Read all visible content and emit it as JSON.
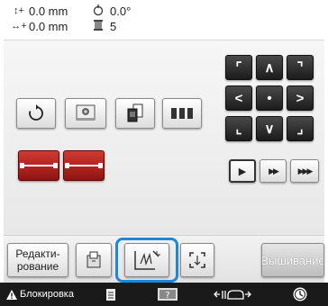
{
  "status": {
    "vertical_icon": "↕+",
    "vertical_offset": "0.0 mm",
    "horizontal_icon": "↔+",
    "horizontal_offset": "0.0 mm",
    "rotation_icon": "rotation-icon",
    "rotation_value": "0.0°",
    "spool_icon": "thread-spool-icon",
    "color_count": "5"
  },
  "edit_buttons": [
    {
      "name": "rotate-button",
      "icon": "rotate-icon"
    },
    {
      "name": "pattern-button",
      "icon": "pattern-icon"
    },
    {
      "name": "copy-button",
      "icon": "copy-pattern-icon"
    },
    {
      "name": "array-button",
      "icon": "array-icon"
    }
  ],
  "stitch_buttons": [
    {
      "name": "stitch-trim-start-button"
    },
    {
      "name": "stitch-trim-end-button"
    }
  ],
  "arrow_pad": {
    "top_left": "⌜",
    "up": "∧",
    "top_right": "⌝",
    "left": "<",
    "center": "•",
    "right": ">",
    "bottom_left": "⌞",
    "down": "∨",
    "bottom_right": "⌟"
  },
  "speed_buttons": [
    "▶",
    "▶▶",
    "▶▶▶"
  ],
  "bottom": {
    "edit_label_line1": "Редакти-",
    "edit_label_line2": "рование",
    "embroider_label": "Вышивание"
  },
  "taskbar": {
    "lock_label": "Блокировка",
    "warning_icon": "warning-icon",
    "tension_icon": "tension-icon"
  },
  "colors": {
    "accent_red": "#b8231d",
    "selection_blue": "#1e88d8",
    "dark_button": "#2a2a2a"
  }
}
